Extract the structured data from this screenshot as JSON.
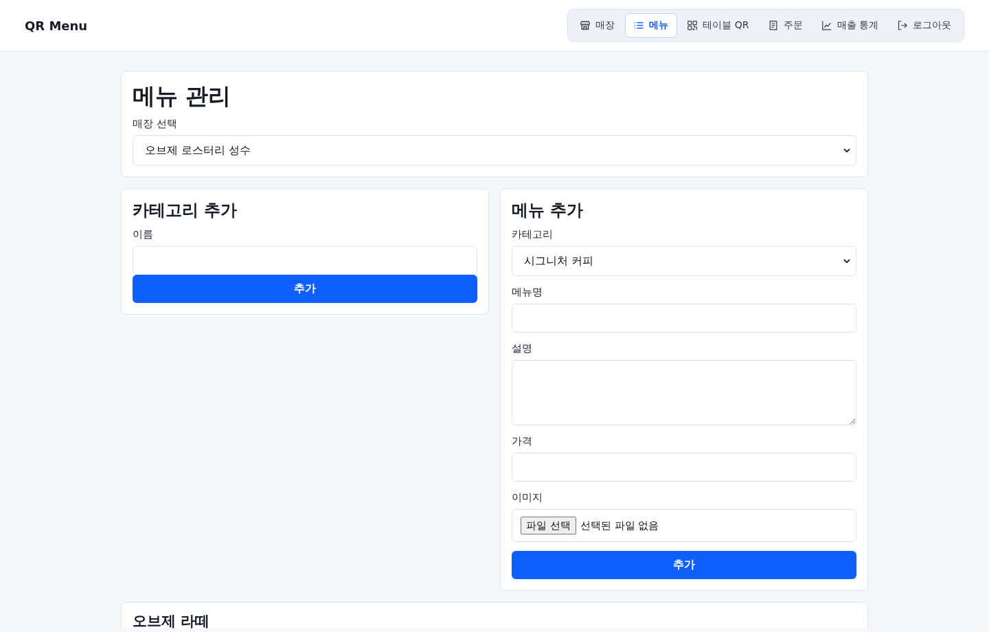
{
  "header": {
    "logo": "QR Menu",
    "nav": [
      {
        "label": "매장",
        "selected": false
      },
      {
        "label": "메뉴",
        "selected": true
      },
      {
        "label": "테이블 QR",
        "selected": false
      },
      {
        "label": "주문",
        "selected": false
      },
      {
        "label": "매출 통계",
        "selected": false
      },
      {
        "label": "로그아웃",
        "selected": false
      }
    ]
  },
  "store_card": {
    "title": "메뉴 관리",
    "fields": [
      {
        "label": "매장 선택",
        "kind": "select",
        "value": "오브제 로스터리 성수"
      }
    ]
  },
  "category_form": {
    "title": "카테고리 추가",
    "fields": [
      {
        "label": "이름",
        "kind": "text"
      }
    ],
    "submit": "추가"
  },
  "menu_form": {
    "title": "메뉴 추가",
    "fields": [
      {
        "label": "카테고리",
        "kind": "select",
        "value": "시그니처 커피"
      },
      {
        "label": "메뉴명",
        "kind": "text"
      },
      {
        "label": "설명",
        "kind": "textarea"
      },
      {
        "label": "가격",
        "kind": "text"
      },
      {
        "label": "이미지",
        "kind": "file",
        "button": "파일 선택",
        "status": "선택된 파일 없음"
      }
    ],
    "submit": "추가"
  },
  "category_section": {
    "title": "오브제 라떼"
  }
}
